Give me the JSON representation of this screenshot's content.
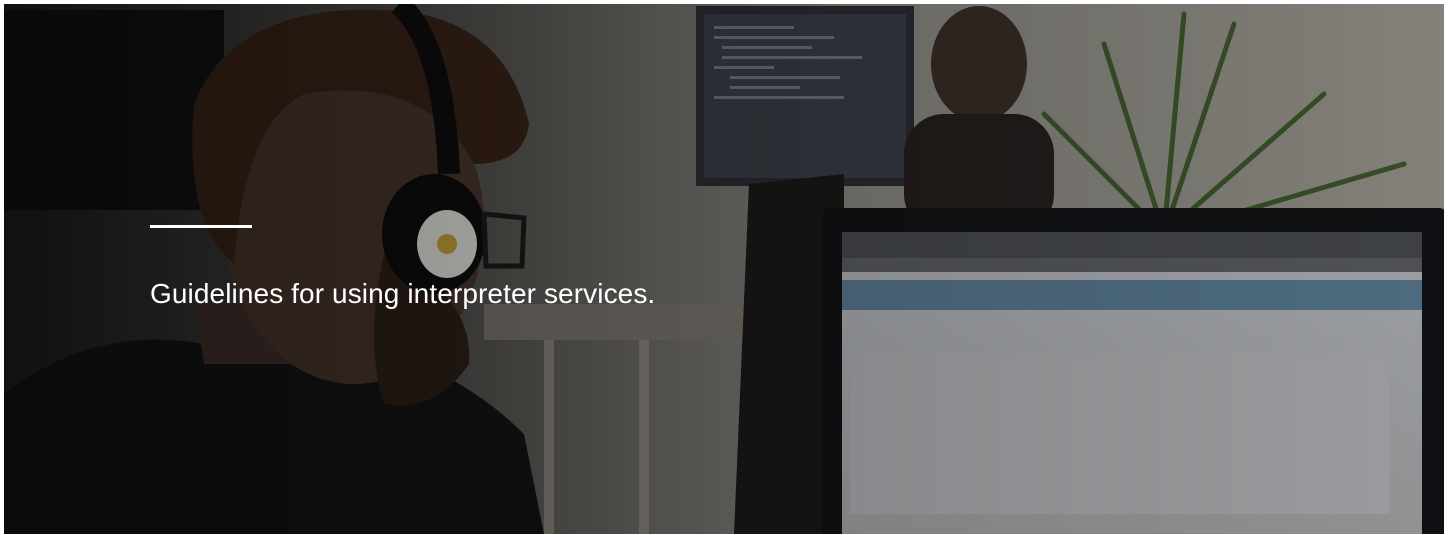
{
  "hero": {
    "heading": "Guidelines for using interpreter services.",
    "background_image": "person-wearing-headphones-at-computer-photo",
    "overlay_color": "#000000",
    "text_color": "#ffffff"
  }
}
